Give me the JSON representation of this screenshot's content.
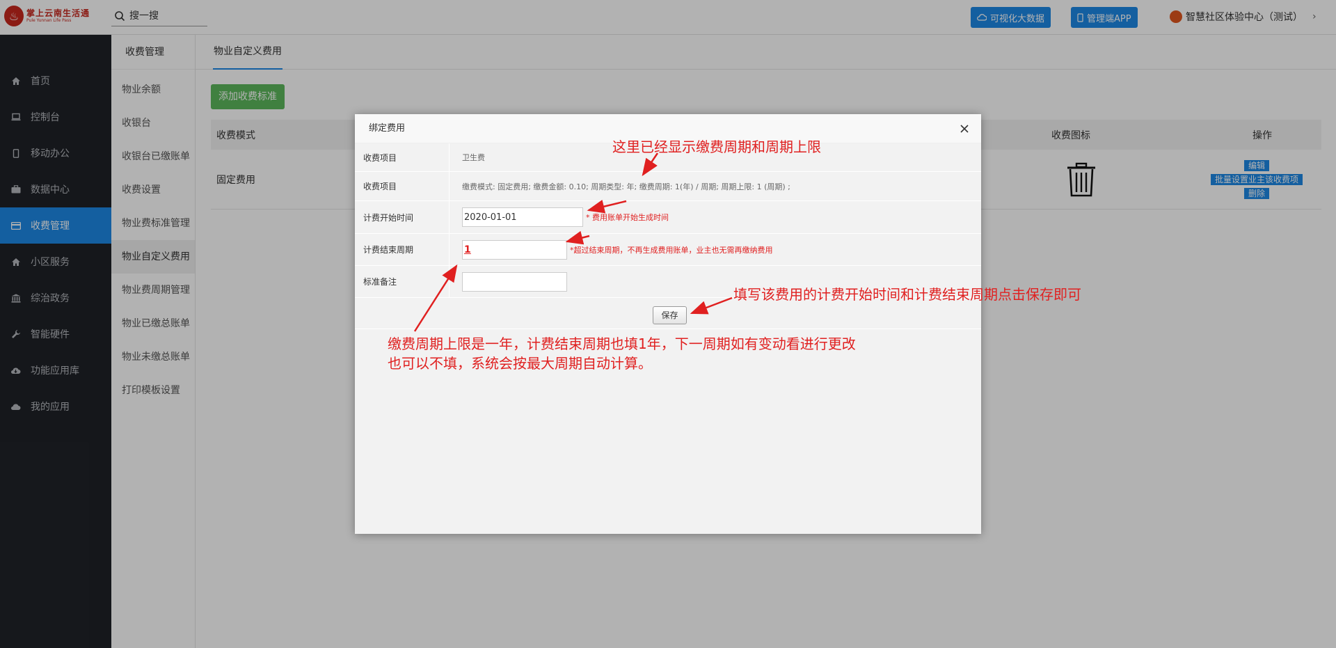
{
  "app": {
    "logo_text": "掌上云南生活通",
    "logo_sub": "Pule Yunnan Life Pass"
  },
  "header": {
    "search_placeholder": "搜一搜",
    "btn_bigdata": "可视化大数据",
    "btn_app": "管理端APP",
    "user_name": "智慧社区体验中心（测试）"
  },
  "sidebar": {
    "items": [
      {
        "label": "首页",
        "icon": "home-icon"
      },
      {
        "label": "控制台",
        "icon": "laptop-icon"
      },
      {
        "label": "移动办公",
        "icon": "mobile-icon"
      },
      {
        "label": "数据中心",
        "icon": "briefcase-icon"
      },
      {
        "label": "收费管理",
        "icon": "credit-card-icon"
      },
      {
        "label": "小区服务",
        "icon": "home-icon"
      },
      {
        "label": "综治政务",
        "icon": "bank-icon"
      },
      {
        "label": "智能硬件",
        "icon": "wrench-icon"
      },
      {
        "label": "功能应用库",
        "icon": "cloud-download-icon"
      },
      {
        "label": "我的应用",
        "icon": "cloud-icon"
      }
    ],
    "active_index": 4
  },
  "submenu": {
    "title": "收费管理",
    "items": [
      "物业余额",
      "收银台",
      "收银台已缴账单",
      "收费设置",
      "物业费标准管理",
      "物业自定义费用",
      "物业费周期管理",
      "物业已缴总账单",
      "物业未缴总账单",
      "打印模板设置"
    ],
    "active_index": 5
  },
  "main": {
    "tab": "物业自定义费用",
    "add_button": "添加收费标准",
    "table": {
      "headers": {
        "mode": "收费模式",
        "icon": "收费图标",
        "ops": "操作"
      },
      "rows": [
        {
          "mode": "固定费用",
          "icon": "trash-icon",
          "op_edit": "编辑",
          "op_batch": "批量设置业主该收费项",
          "op_delete": "删除"
        }
      ]
    }
  },
  "modal": {
    "title": "绑定费用",
    "rows": [
      {
        "label": "收费项目",
        "value": "卫生费"
      },
      {
        "label": "收费项目",
        "value": "缴费模式: 固定费用; 缴费金额: 0.10; 周期类型: 年; 缴费周期: 1(年) / 周期; 周期上限: 1 (周期) ;"
      }
    ],
    "start_label": "计费开始时间",
    "start_value": "2020-01-01",
    "start_hint": "* 费用账单开始生成时间",
    "end_label": "计费结束周期",
    "end_value": "1",
    "end_hint": "*超过结束周期，不再生成费用账单，业主也无需再缴纳费用",
    "remark_label": "标准备注",
    "remark_value": "",
    "save": "保存"
  },
  "annotations": {
    "a1": "这里已经显示缴费周期和周期上限",
    "a2": "填写该费用的计费开始时间和计费结束周期点击保存即可",
    "a3_line1": "缴费周期上限是一年，计费结束周期也填1年，下一周期如有变动看进行更改",
    "a3_line2": "也可以不填，系统会按最大周期自动计算。",
    "color": "#e02020"
  },
  "colors": {
    "primary": "#1e88e5",
    "sidebar_bg": "#1f2228",
    "add_button": "#5cb85c"
  }
}
